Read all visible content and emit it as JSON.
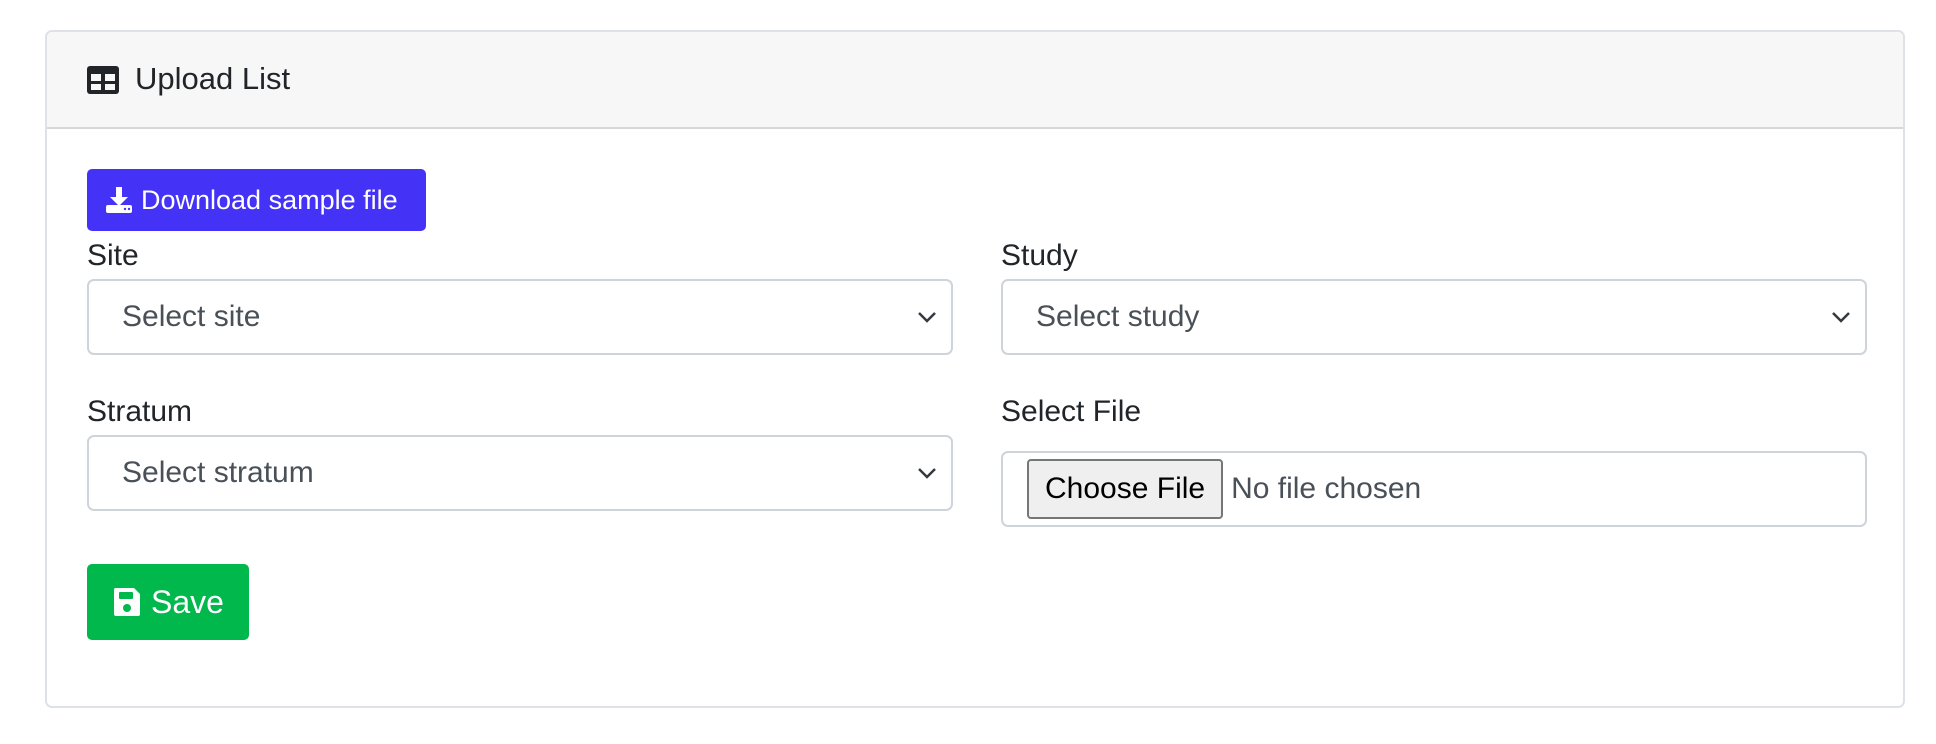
{
  "card": {
    "title": "Upload List",
    "icon": "table-icon"
  },
  "download_button": {
    "label": "Download sample file",
    "icon": "download-icon",
    "color": "#4433f6"
  },
  "fields": {
    "site": {
      "label": "Site",
      "selected": "Select site"
    },
    "study": {
      "label": "Study",
      "selected": "Select study"
    },
    "stratum": {
      "label": "Stratum",
      "selected": "Select stratum"
    },
    "file": {
      "label": "Select File",
      "button_label": "Choose File",
      "status": "No file chosen"
    }
  },
  "save_button": {
    "label": "Save",
    "icon": "floppy-disk-icon",
    "color": "#00b84b"
  }
}
